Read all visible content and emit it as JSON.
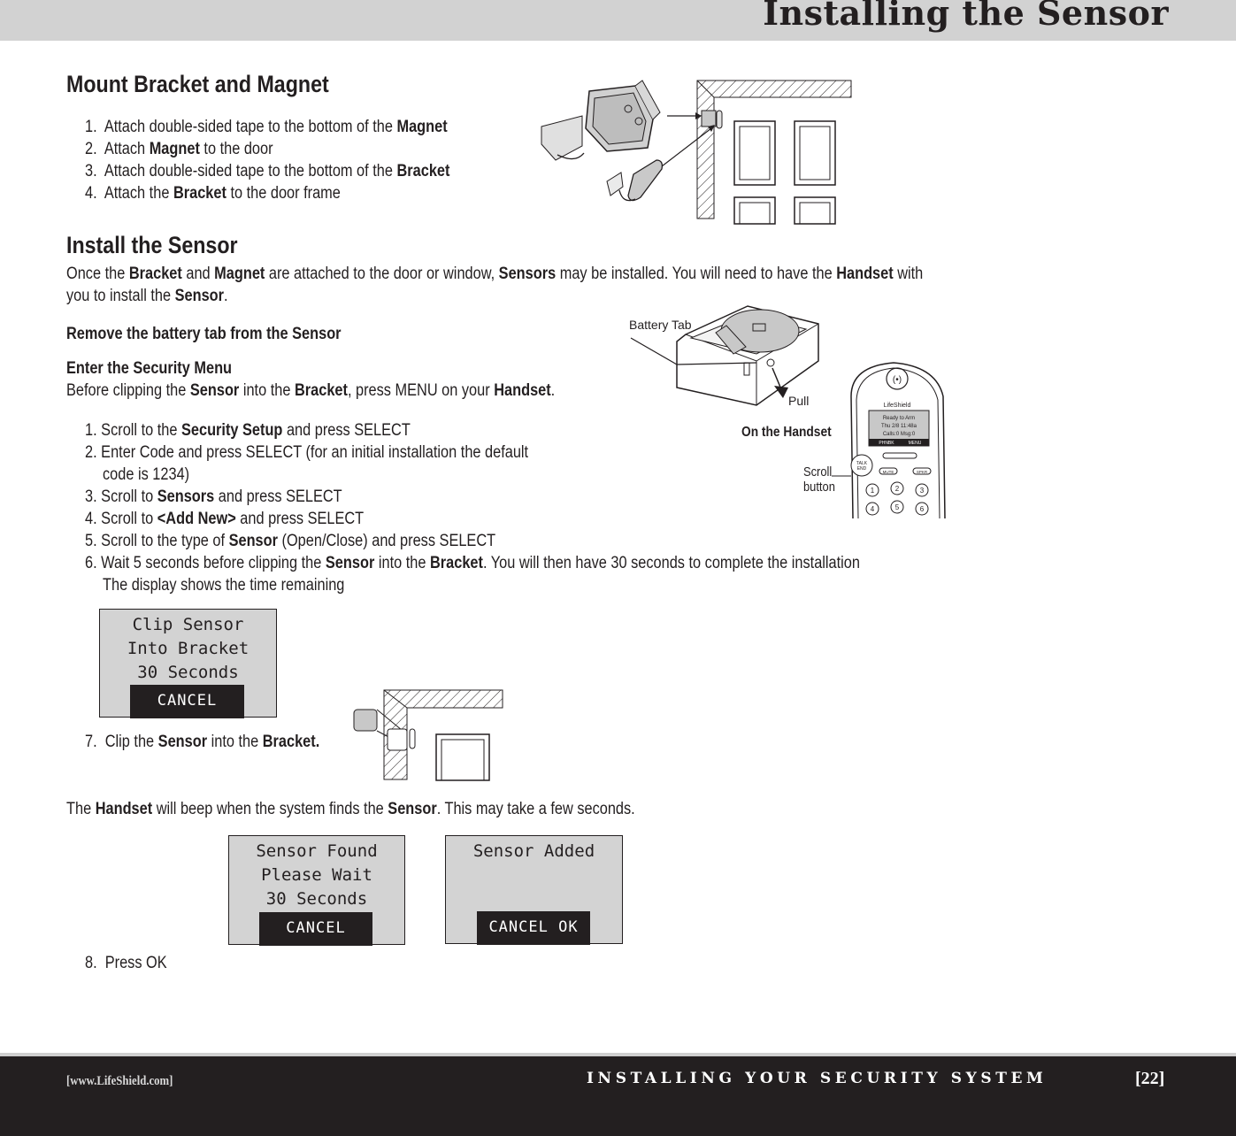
{
  "header": {
    "title": "Installing the Sensor"
  },
  "mount_section": {
    "heading": "Mount Bracket and Magnet",
    "steps": [
      {
        "num": "1.",
        "pre": "Attach double-sided tape to the bottom of the ",
        "bold": "Magnet",
        "post": ""
      },
      {
        "num": "2.",
        "pre": "Attach ",
        "bold": "Magnet",
        "post": " to the door"
      },
      {
        "num": "3.",
        "pre": "Attach double-sided tape to the bottom of the ",
        "bold": "Bracket",
        "post": ""
      },
      {
        "num": "4.",
        "pre": "Attach the ",
        "bold": "Bracket",
        "post": " to the door frame"
      }
    ]
  },
  "install_section": {
    "heading": "Install the Sensor",
    "intro": {
      "p1": "Once the ",
      "b1": "Bracket",
      "p2": " and ",
      "b2": "Magnet",
      "p3": " are attached to the door or window, ",
      "b3": "Sensors",
      "p4": " may be installed.  You will need to have the ",
      "b4": "Handset",
      "p5": " with",
      "p6": "you to install the ",
      "b5": "Sensor",
      "p7": "."
    },
    "battery_heading": "Remove the battery tab from the Sensor",
    "menu_heading": "Enter the Security Menu",
    "menu_text": {
      "p1": "Before clipping the ",
      "b1": "Sensor",
      "p2": " into the ",
      "b2": "Bracket",
      "p3": ", press MENU on your ",
      "b3": "Handset",
      "p4": "."
    },
    "steps": [
      {
        "num": "1.",
        "pre": "Scroll to the ",
        "bold": "Security Setup",
        "post": " and press SELECT"
      },
      {
        "num": "2.",
        "pre": "Enter Code and press SELECT (for an initial installation the default",
        "bold": "",
        "post": ""
      },
      {
        "num": "",
        "pre": "code is 1234)",
        "bold": "",
        "post": ""
      },
      {
        "num": "3.",
        "pre": "Scroll to ",
        "bold": "Sensors",
        "post": " and press SELECT"
      },
      {
        "num": "4.",
        "pre": "Scroll to ",
        "bold": "<Add New>",
        "post": " and press SELECT"
      },
      {
        "num": "5.",
        "pre": " Scroll to the type of ",
        "bold": "Sensor",
        "post": " (Open/Close) and press SELECT"
      }
    ],
    "step6": {
      "num": "6.",
      "p1": "Wait 5 seconds before clipping the ",
      "b1": "Sensor",
      "p2": " into the ",
      "b2": "Bracket",
      "p3": ". You will then have 30 seconds to complete the installation",
      "line2": "The display shows the time remaining"
    },
    "step7": {
      "num": "7.",
      "p1": "Clip the ",
      "b1": "Sensor",
      "p2": " into the ",
      "b2": "Bracket."
    },
    "beep_text": {
      "p1": "The ",
      "b1": "Handset",
      "p2": " will beep when the system finds the ",
      "b2": "Sensor",
      "p3": ". This may take a few seconds."
    },
    "step8": {
      "num": "8.",
      "text": "Press OK"
    }
  },
  "lcd_screens": {
    "clip": {
      "lines": [
        "Clip Sensor",
        "Into Bracket",
        "30 Seconds"
      ],
      "softkey": "CANCEL"
    },
    "found": {
      "lines": [
        "Sensor Found",
        "Please Wait",
        "30 Seconds"
      ],
      "softkey": "CANCEL"
    },
    "added": {
      "lines": [
        "Sensor Added"
      ],
      "softkey": "CANCEL OK"
    }
  },
  "illustrations": {
    "battery_tab_label": "Battery Tab",
    "pull_label": "Pull",
    "handset_caption": "On the Handset",
    "scroll_label_1": "Scroll",
    "scroll_label_2": "button",
    "handset_brand": "LifeShield",
    "handset_screen": [
      "Ready to Arm",
      "Thu 2/8 11:48a",
      "Calls:0  Msg:0"
    ],
    "handset_softkeys": [
      "PHNBK",
      "MENU"
    ],
    "handset_talk": [
      "TALK",
      "END"
    ],
    "handset_buttons": [
      "MUTE",
      "SPKR"
    ],
    "handset_keys": [
      "1",
      "2",
      "3",
      "4",
      "5",
      "6"
    ]
  },
  "footer": {
    "url": "[www.LifeShield.com]",
    "section": "INSTALLING YOUR SECURITY SYSTEM",
    "page": "[22]"
  },
  "colors": {
    "header_bg": "#d2d2d2",
    "text": "#231f20",
    "lcd_bg": "#d3d3d3",
    "footer_bg": "#231f20"
  }
}
